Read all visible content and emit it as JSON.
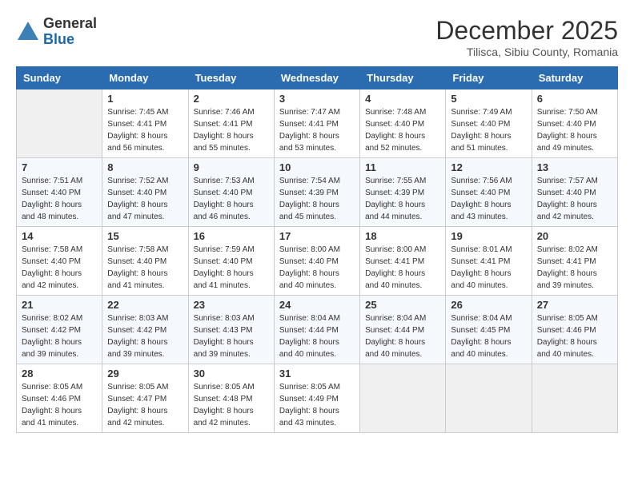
{
  "header": {
    "logo_general": "General",
    "logo_blue": "Blue",
    "month_title": "December 2025",
    "subtitle": "Tilisca, Sibiu County, Romania"
  },
  "days_of_week": [
    "Sunday",
    "Monday",
    "Tuesday",
    "Wednesday",
    "Thursday",
    "Friday",
    "Saturday"
  ],
  "weeks": [
    [
      {
        "day": "",
        "info": ""
      },
      {
        "day": "1",
        "info": "Sunrise: 7:45 AM\nSunset: 4:41 PM\nDaylight: 8 hours\nand 56 minutes."
      },
      {
        "day": "2",
        "info": "Sunrise: 7:46 AM\nSunset: 4:41 PM\nDaylight: 8 hours\nand 55 minutes."
      },
      {
        "day": "3",
        "info": "Sunrise: 7:47 AM\nSunset: 4:41 PM\nDaylight: 8 hours\nand 53 minutes."
      },
      {
        "day": "4",
        "info": "Sunrise: 7:48 AM\nSunset: 4:40 PM\nDaylight: 8 hours\nand 52 minutes."
      },
      {
        "day": "5",
        "info": "Sunrise: 7:49 AM\nSunset: 4:40 PM\nDaylight: 8 hours\nand 51 minutes."
      },
      {
        "day": "6",
        "info": "Sunrise: 7:50 AM\nSunset: 4:40 PM\nDaylight: 8 hours\nand 49 minutes."
      }
    ],
    [
      {
        "day": "7",
        "info": "Sunrise: 7:51 AM\nSunset: 4:40 PM\nDaylight: 8 hours\nand 48 minutes."
      },
      {
        "day": "8",
        "info": "Sunrise: 7:52 AM\nSunset: 4:40 PM\nDaylight: 8 hours\nand 47 minutes."
      },
      {
        "day": "9",
        "info": "Sunrise: 7:53 AM\nSunset: 4:40 PM\nDaylight: 8 hours\nand 46 minutes."
      },
      {
        "day": "10",
        "info": "Sunrise: 7:54 AM\nSunset: 4:39 PM\nDaylight: 8 hours\nand 45 minutes."
      },
      {
        "day": "11",
        "info": "Sunrise: 7:55 AM\nSunset: 4:39 PM\nDaylight: 8 hours\nand 44 minutes."
      },
      {
        "day": "12",
        "info": "Sunrise: 7:56 AM\nSunset: 4:40 PM\nDaylight: 8 hours\nand 43 minutes."
      },
      {
        "day": "13",
        "info": "Sunrise: 7:57 AM\nSunset: 4:40 PM\nDaylight: 8 hours\nand 42 minutes."
      }
    ],
    [
      {
        "day": "14",
        "info": "Sunrise: 7:58 AM\nSunset: 4:40 PM\nDaylight: 8 hours\nand 42 minutes."
      },
      {
        "day": "15",
        "info": "Sunrise: 7:58 AM\nSunset: 4:40 PM\nDaylight: 8 hours\nand 41 minutes."
      },
      {
        "day": "16",
        "info": "Sunrise: 7:59 AM\nSunset: 4:40 PM\nDaylight: 8 hours\nand 41 minutes."
      },
      {
        "day": "17",
        "info": "Sunrise: 8:00 AM\nSunset: 4:40 PM\nDaylight: 8 hours\nand 40 minutes."
      },
      {
        "day": "18",
        "info": "Sunrise: 8:00 AM\nSunset: 4:41 PM\nDaylight: 8 hours\nand 40 minutes."
      },
      {
        "day": "19",
        "info": "Sunrise: 8:01 AM\nSunset: 4:41 PM\nDaylight: 8 hours\nand 40 minutes."
      },
      {
        "day": "20",
        "info": "Sunrise: 8:02 AM\nSunset: 4:41 PM\nDaylight: 8 hours\nand 39 minutes."
      }
    ],
    [
      {
        "day": "21",
        "info": "Sunrise: 8:02 AM\nSunset: 4:42 PM\nDaylight: 8 hours\nand 39 minutes."
      },
      {
        "day": "22",
        "info": "Sunrise: 8:03 AM\nSunset: 4:42 PM\nDaylight: 8 hours\nand 39 minutes."
      },
      {
        "day": "23",
        "info": "Sunrise: 8:03 AM\nSunset: 4:43 PM\nDaylight: 8 hours\nand 39 minutes."
      },
      {
        "day": "24",
        "info": "Sunrise: 8:04 AM\nSunset: 4:44 PM\nDaylight: 8 hours\nand 40 minutes."
      },
      {
        "day": "25",
        "info": "Sunrise: 8:04 AM\nSunset: 4:44 PM\nDaylight: 8 hours\nand 40 minutes."
      },
      {
        "day": "26",
        "info": "Sunrise: 8:04 AM\nSunset: 4:45 PM\nDaylight: 8 hours\nand 40 minutes."
      },
      {
        "day": "27",
        "info": "Sunrise: 8:05 AM\nSunset: 4:46 PM\nDaylight: 8 hours\nand 40 minutes."
      }
    ],
    [
      {
        "day": "28",
        "info": "Sunrise: 8:05 AM\nSunset: 4:46 PM\nDaylight: 8 hours\nand 41 minutes."
      },
      {
        "day": "29",
        "info": "Sunrise: 8:05 AM\nSunset: 4:47 PM\nDaylight: 8 hours\nand 42 minutes."
      },
      {
        "day": "30",
        "info": "Sunrise: 8:05 AM\nSunset: 4:48 PM\nDaylight: 8 hours\nand 42 minutes."
      },
      {
        "day": "31",
        "info": "Sunrise: 8:05 AM\nSunset: 4:49 PM\nDaylight: 8 hours\nand 43 minutes."
      },
      {
        "day": "",
        "info": ""
      },
      {
        "day": "",
        "info": ""
      },
      {
        "day": "",
        "info": ""
      }
    ]
  ]
}
